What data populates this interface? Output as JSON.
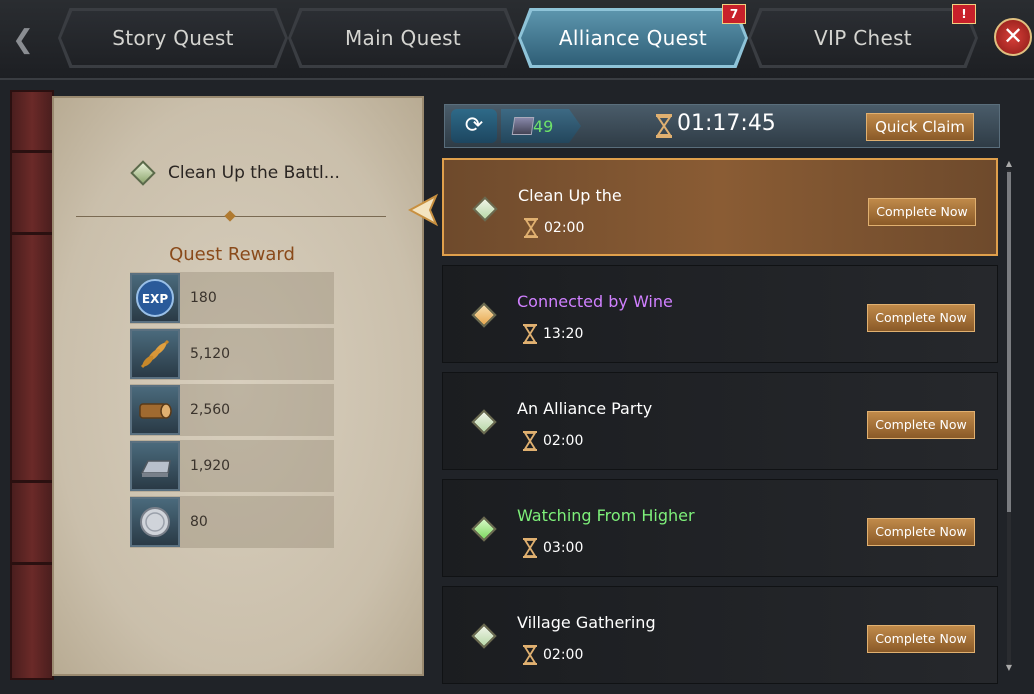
{
  "tabs": [
    {
      "label": "Story Quest",
      "active": false,
      "badge": ""
    },
    {
      "label": "Main Quest",
      "active": false,
      "badge": ""
    },
    {
      "label": "Alliance Quest",
      "active": true,
      "badge": "7"
    },
    {
      "label": "VIP Chest",
      "active": false,
      "badge": "!"
    }
  ],
  "selected_quest": {
    "title": "Clean Up the Battl...",
    "reward_heading": "Quest Reward",
    "rewards": [
      {
        "icon": "exp-icon",
        "value": "180"
      },
      {
        "icon": "wheat-icon",
        "value": "5,120"
      },
      {
        "icon": "wood-log-icon",
        "value": "2,560"
      },
      {
        "icon": "iron-ingot-icon",
        "value": "1,920"
      },
      {
        "icon": "silver-coin-icon",
        "value": "80"
      }
    ]
  },
  "timer_bar": {
    "tickets": "49",
    "timer": "01:17:45",
    "quick_claim_label": "Quick Claim"
  },
  "quests": [
    {
      "name": "Clean Up the",
      "time": "02:00",
      "rarity_color": "#ffffff",
      "diamond_color": "#b8d8a8",
      "button": "Complete Now",
      "selected": true
    },
    {
      "name": "Connected by Wine",
      "time": "13:20",
      "rarity_color": "#d080ff",
      "diamond_color": "#e8a850",
      "button": "Complete Now",
      "selected": false
    },
    {
      "name": "An Alliance Party",
      "time": "02:00",
      "rarity_color": "#ffffff",
      "diamond_color": "#b8d8a8",
      "button": "Complete Now",
      "selected": false
    },
    {
      "name": "Watching From Higher",
      "time": "03:00",
      "rarity_color": "#7ef07a",
      "diamond_color": "#7ed860",
      "button": "Complete Now",
      "selected": false
    },
    {
      "name": "Village Gathering",
      "time": "02:00",
      "rarity_color": "#ffffff",
      "diamond_color": "#b8d8a8",
      "button": "Complete Now",
      "selected": false
    }
  ],
  "colors": {
    "accent_gold": "#e0a04c",
    "active_tab": "#5c95ad",
    "ticket_count": "#6ee26a"
  }
}
